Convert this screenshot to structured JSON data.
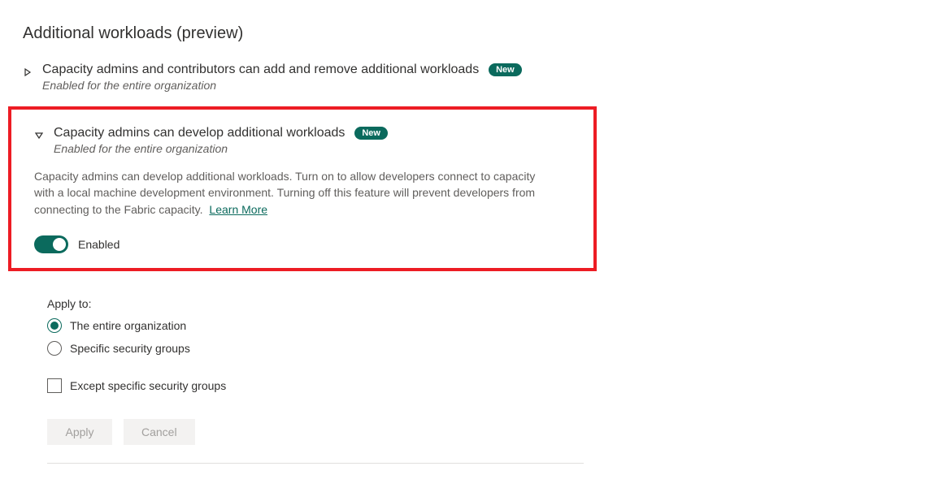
{
  "section_title": "Additional workloads (preview)",
  "setting1": {
    "title": "Capacity admins and contributors can add and remove additional workloads",
    "badge": "New",
    "subtitle": "Enabled for the entire organization"
  },
  "setting2": {
    "title": "Capacity admins can develop additional workloads",
    "badge": "New",
    "subtitle": "Enabled for the entire organization",
    "description": "Capacity admins can develop additional workloads. Turn on to allow developers connect to capacity with a local machine development environment. Turning off this feature will prevent developers from connecting to the Fabric capacity.",
    "learn_more": "Learn More",
    "toggle_state": "Enabled"
  },
  "apply": {
    "label": "Apply to:",
    "option_entire": "The entire organization",
    "option_groups": "Specific security groups",
    "except_label": "Except specific security groups"
  },
  "buttons": {
    "apply": "Apply",
    "cancel": "Cancel"
  }
}
